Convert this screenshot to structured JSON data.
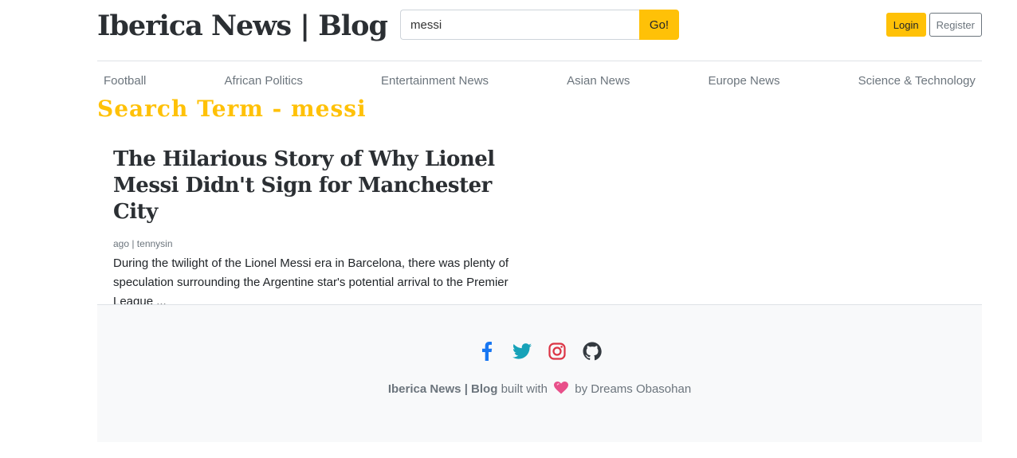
{
  "header": {
    "logo": "Iberica News | Blog",
    "search": {
      "value": "messi",
      "placeholder": "",
      "button_label": "Go!"
    },
    "login_label": "Login",
    "register_label": "Register"
  },
  "nav": {
    "items": [
      {
        "label": "Football"
      },
      {
        "label": "African Politics"
      },
      {
        "label": "Entertainment News"
      },
      {
        "label": "Asian News"
      },
      {
        "label": "Europe News"
      },
      {
        "label": "Science & Technology"
      }
    ]
  },
  "search_term": "Search Term - messi",
  "posts": [
    {
      "title": "The Hilarious Story of Why Lionel Messi Didn't Sign for Manchester City",
      "meta": "ago | tennysin",
      "excerpt": "During the twilight of the Lionel Messi era in Barcelona, there was plenty of speculation surrounding the Argentine star's potential arrival to the Premier League ..."
    }
  ],
  "footer": {
    "social_icons": [
      "facebook-icon",
      "twitter-icon",
      "instagram-icon",
      "github-icon"
    ],
    "brand": "Iberica News | Blog",
    "built_with": "built with",
    "by": "by Dreams Obasohan"
  },
  "colors": {
    "accent": "#ffc107",
    "facebook": "#1877f2",
    "twitter": "#17a2b8",
    "instagram": "#dc3545",
    "github": "#343a40"
  }
}
